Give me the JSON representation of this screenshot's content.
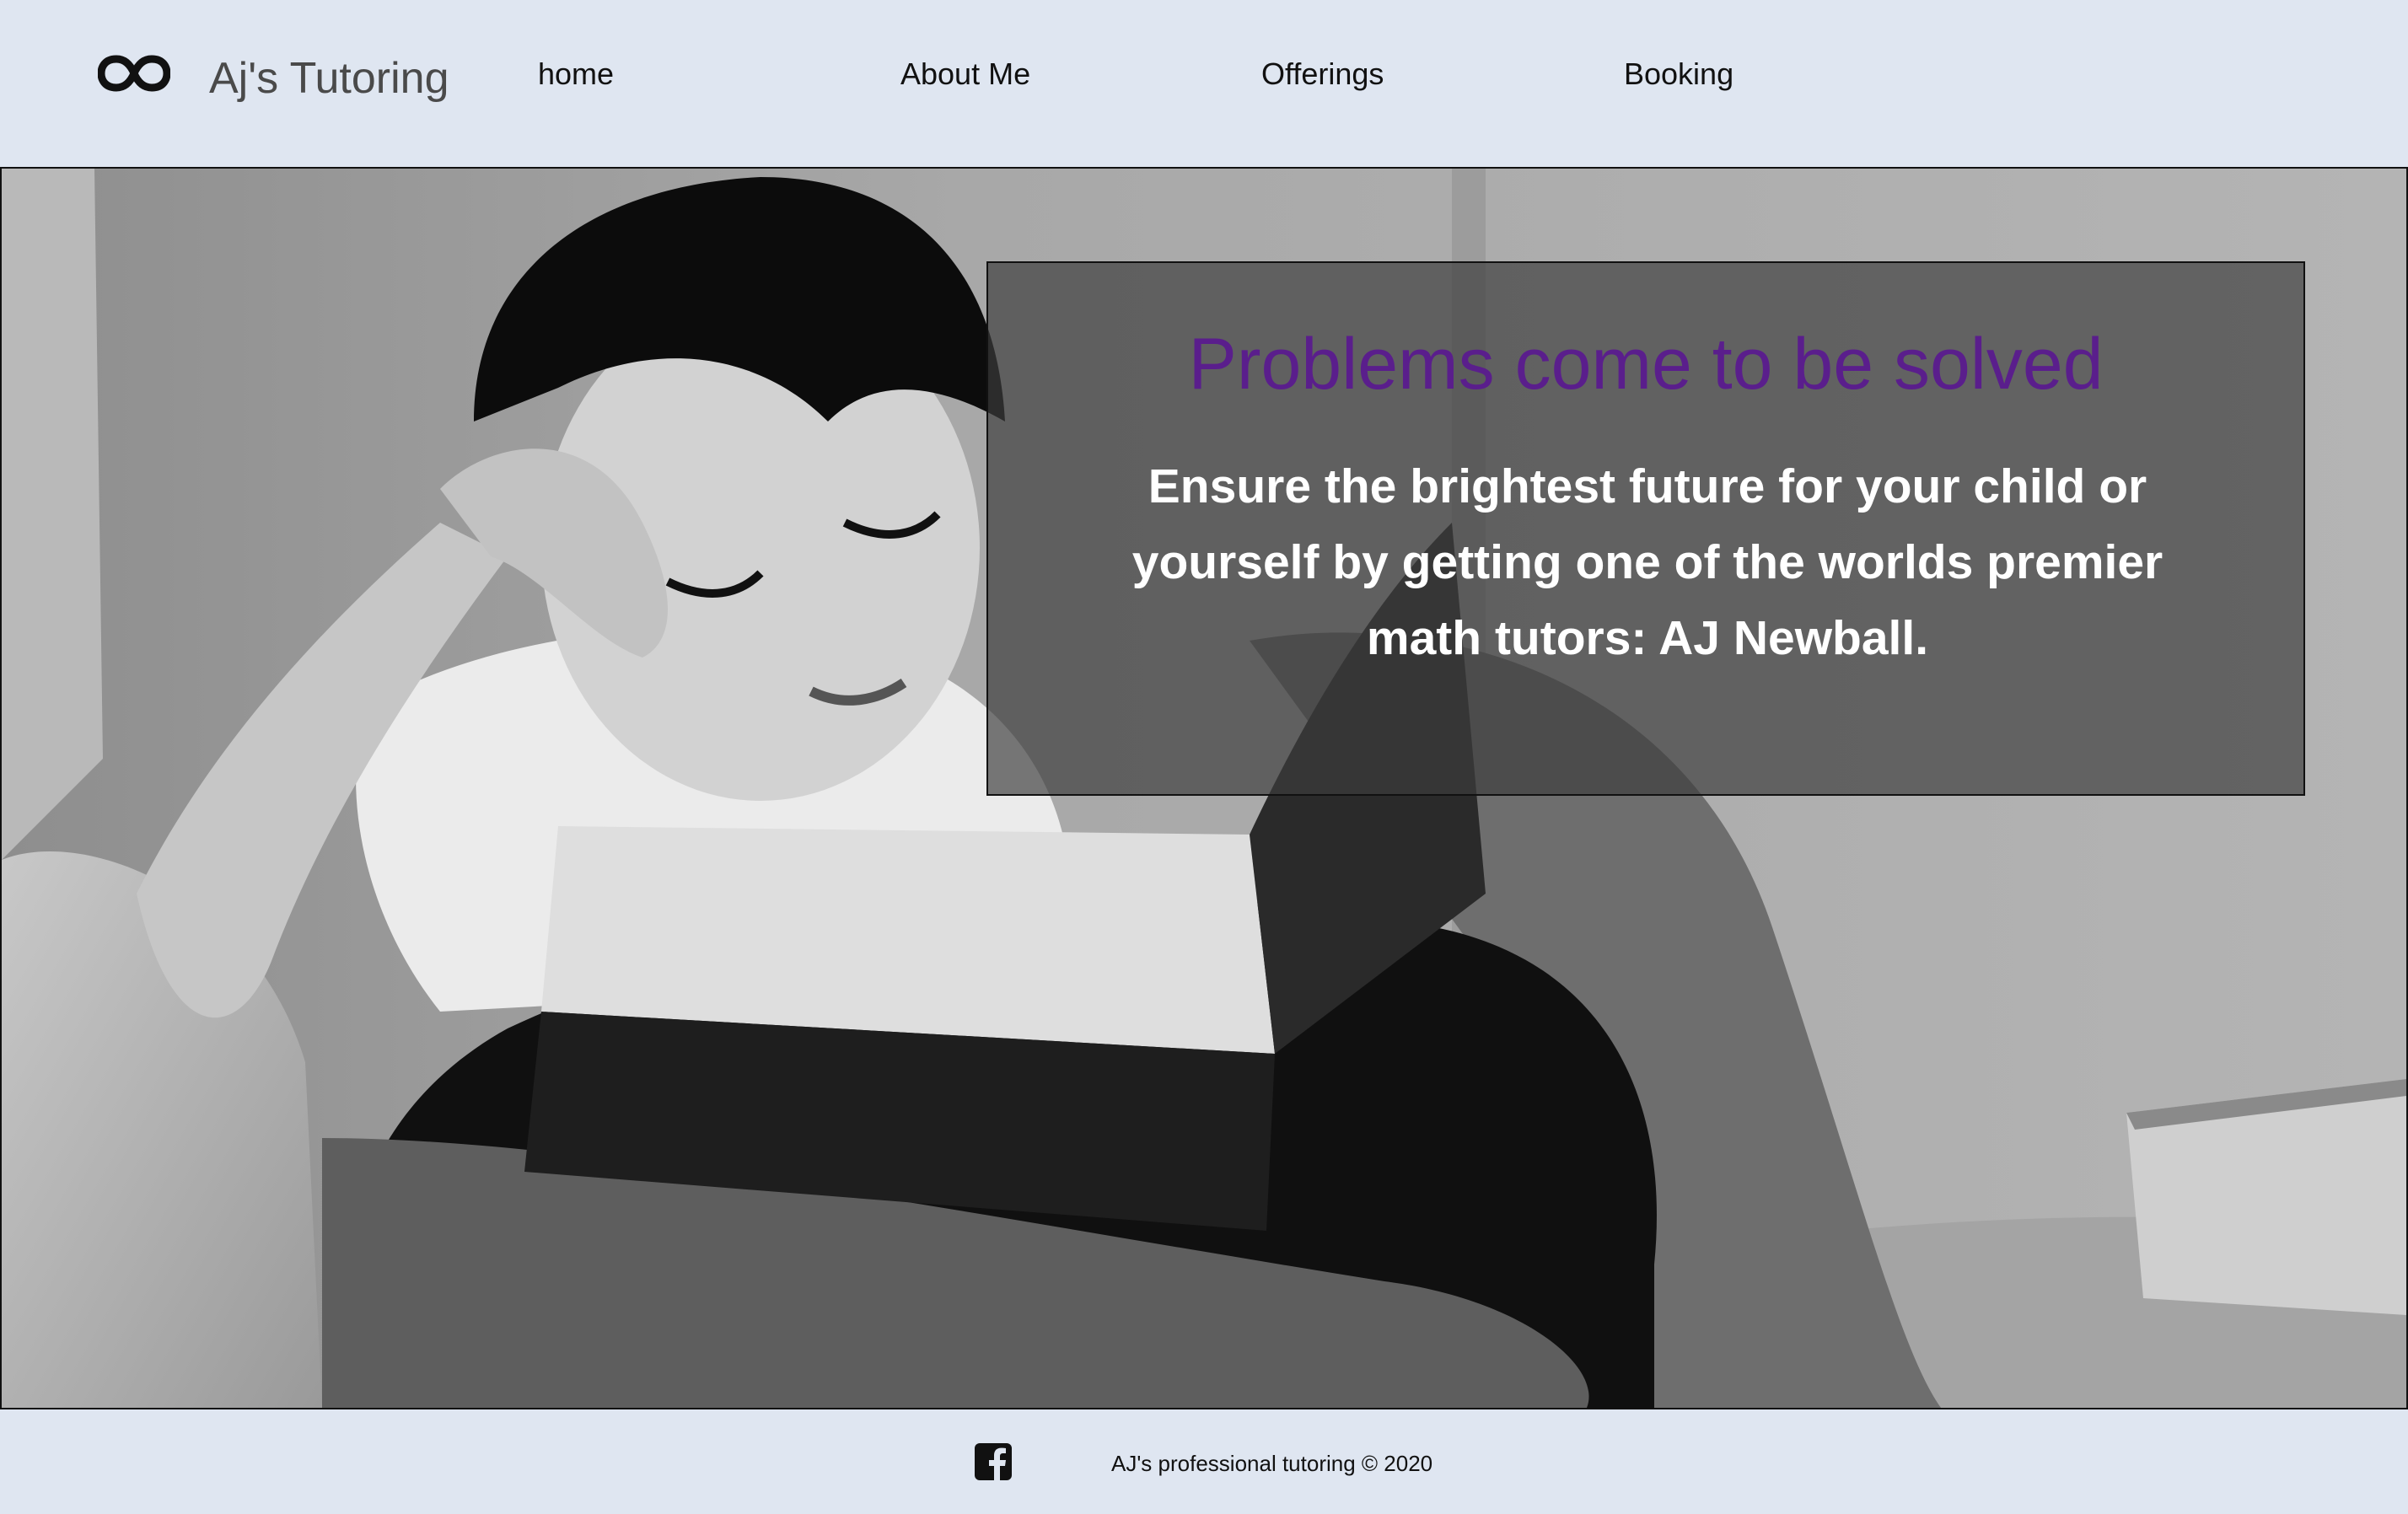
{
  "header": {
    "logo_icon": "infinity-icon",
    "brand": "Aj's Tutoring",
    "nav": [
      {
        "label": "home"
      },
      {
        "label": "About Me"
      },
      {
        "label": "Offerings"
      },
      {
        "label": "Booking"
      }
    ]
  },
  "hero": {
    "title": "Problems come to be solved",
    "body": "Ensure the brightest future for your child or yourself by getting one of the worlds premier math tutors: AJ Newball.",
    "image": "photo of boy reading a book",
    "title_color": "#5a1e8c"
  },
  "footer": {
    "social_icon": "facebook-icon",
    "copyright": "AJ's professional tutoring © 2020"
  },
  "colors": {
    "background": "#dfe6f1",
    "accent": "#5a1e8c"
  }
}
